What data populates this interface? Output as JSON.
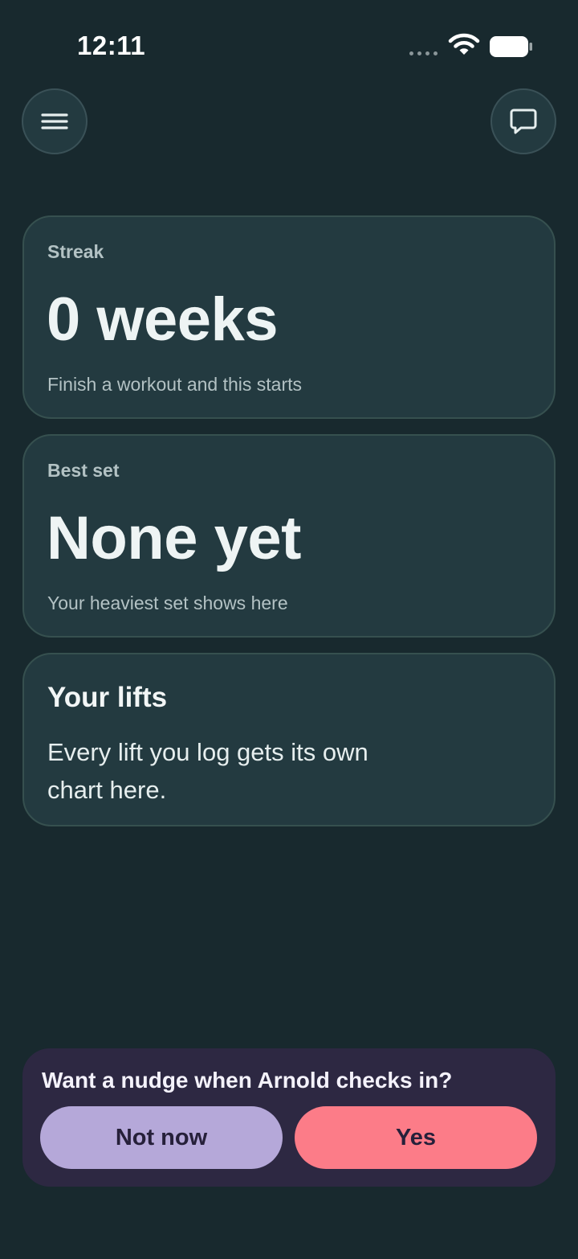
{
  "status_bar": {
    "time": "12:11"
  },
  "header": {
    "menu_icon": "hamburger-menu-icon",
    "chat_icon": "chat-bubble-icon"
  },
  "streak_card": {
    "label": "Streak",
    "value": "0 weeks",
    "hint": "Finish a workout and this starts"
  },
  "best_set_card": {
    "label": "Best set",
    "value": "None yet",
    "hint": "Your heaviest set shows here"
  },
  "lifts_card": {
    "title": "Your lifts",
    "body": "Every lift you log gets its own chart here."
  },
  "nudge": {
    "prompt": "Want a nudge when Arnold checks in?",
    "decline_label": "Not now",
    "accept_label": "Yes"
  },
  "colors": {
    "background": "#18292e",
    "card": "#233a40",
    "nudge_background": "#2d2842",
    "decline_button": "#b5a8d9",
    "accept_button": "#fc7c88"
  }
}
